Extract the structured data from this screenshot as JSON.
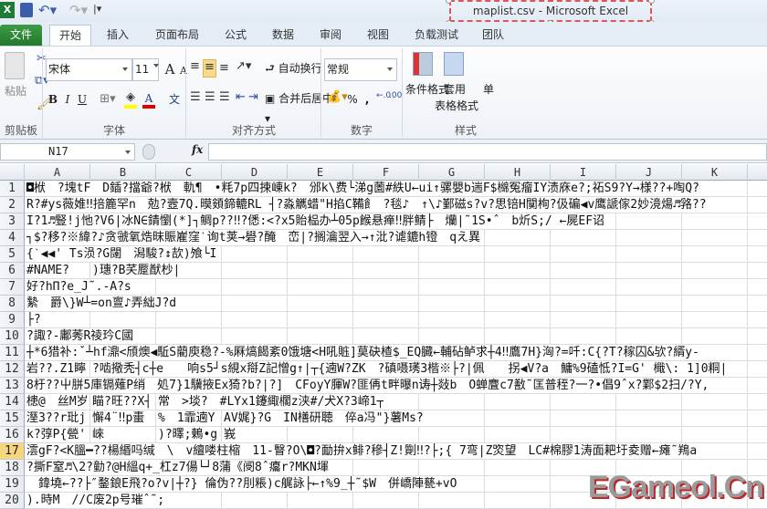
{
  "window": {
    "title": "maplist.csv  -  Microsoft Excel"
  },
  "ribbon_tabs": [
    "文件",
    "开始",
    "插入",
    "页面布局",
    "公式",
    "数据",
    "审阅",
    "视图",
    "负载测试",
    "团队"
  ],
  "active_tab": "开始",
  "clipboard": {
    "paste": "粘贴",
    "label": "剪贴板"
  },
  "font": {
    "name": "宋体",
    "size": "11",
    "label": "字体",
    "bold": "B",
    "italic": "I",
    "underline": "U",
    "grow": "A",
    "shrink": "A",
    "color_letter": "A",
    "phonetic": "文",
    "fill_color": "#ffff00",
    "font_color": "#e00000"
  },
  "alignment": {
    "wrap": "自动换行",
    "merge": "合并后居中",
    "label": "对齐方式"
  },
  "number": {
    "format": "常规",
    "label": "数字",
    "percent": "%",
    "comma": ","
  },
  "styles": {
    "conditional": "条件格式",
    "table_format_1": "套用",
    "table_format_2": "表格格式",
    "cell_styles": "单",
    "label": "样式"
  },
  "formula_bar": {
    "name_box": "N17",
    "fx": "fx",
    "value": ""
  },
  "columns": [
    "A",
    "B",
    "C",
    "D",
    "E",
    "F",
    "G",
    "H",
    "I",
    "J",
    "K"
  ],
  "selected_row": 17,
  "rows": [
    {
      "n": "1",
      "cells": [
        {
          "c": 0,
          "t": "◘栿　?塊tF　D鍤?擋爺?栿　軌¶　•粍7p四捒崠k?　邠k\\费└涕g薗#紩U←ui↑骡嬰b遄F$檰冤瘤IY渍庥e?;祏S9?Y→様??+啕Q?"
        }
      ]
    },
    {
      "n": "2",
      "cells": [
        {
          "c": 0,
          "t": "R?#ys薇婎‼掊簏罕n　勊?壼7Q.暯頞鍗轆RL ┤?淼觽蜡\"H掐C鞴飠 ?毯♪　↑\\♪鄞磁s?v?思锫H闃栒?伋碥◀v鹰謕傢2妙滰煬♬嗠??"
        }
      ]
    },
    {
      "n": "3",
      "cells": [
        {
          "c": 0,
          "t": "I?1♬豎!j忚?V6|冰N∈錆懰(*]┐鲷p??‼?僁:<?x5貽榀办┴05p餱悬瘅‼胖鲭├　爤|˜1S•ˆ　b炘S;/ ←屍EF诏"
        }
      ]
    },
    {
      "n": "4",
      "cells": [
        {
          "c": 0,
          "t": "┐$?移?※緯?♪贪虢氧焅昩賑嵟窪ˋ询t荚→礐?醃　峦|?搁瀹翌入→↑沘?谑鏕h镫　qえ異"
        }
      ]
    },
    {
      "n": "5",
      "cells": [
        {
          "c": 0,
          "t": "{ˋ◀◀' Ts涢?G闥　潟駿?↕欯)飧└I"
        }
      ]
    },
    {
      "n": "6",
      "cells": [
        {
          "c": 0,
          "t": " #NAME? "
        },
        {
          "c": 1,
          "t": ")璤?B芺蹷猷杪|"
        }
      ]
    },
    {
      "n": "7",
      "cells": [
        {
          "c": 0,
          "t": "好?hΠ?e_J˜.-A?s"
        }
      ]
    },
    {
      "n": "8",
      "cells": [
        {
          "c": 0,
          "t": "縶　爵\\}W┴=on亶♪弄絀J?d"
        }
      ]
    },
    {
      "n": "9",
      "cells": [
        {
          "c": 0,
          "t": "├?"
        }
      ]
    },
    {
      "n": "10",
      "cells": [
        {
          "c": 0,
          "t": "?諏?-鄘莠R祾玪C國"
        }
      ]
    },
    {
      "n": "11",
      "cells": [
        {
          "c": 0,
          "t": "┼*6猎补:ˇ┴hf濎<頎燠◀駈S藺庾稳?-%厤熇餲紊0饿塘<H吼賘]莫砄楂$_EQ臓←輔砧鲈求┼4‼鷹7H}洶?=吀:C{?T?稼囚&欤?縃y-"
        }
      ]
    },
    {
      "n": "12",
      "cells": [
        {
          "c": 0,
          "t": "岩??.Z1矃"
        },
        {
          "c": 1,
          "t": "?啮擏秃┤c┼e　　响s5┘s絸x搿Z記憎g↑|┬{遖W?ZK　?磌嗫璓3楷※├?|佩　　拐◀V?a　鱅%9磕怟?I=G' 檝\\: 1]0粡|"
        }
      ]
    },
    {
      "n": "13",
      "cells": [
        {
          "c": 0,
          "t": "8杅??屮胼5庫镉薙P绡　処7}1驥掖Ex猗?b?|?]　CFoyY腪W?匪侢t畔曝n诪┼敥b　O蝉麆c7敾˜匡普秷?一?•倡9ˆx?鄴$2扫/?Y,"
        }
      ]
    },
    {
      "n": "14",
      "cells": [
        {
          "c": 0,
          "t": "槵@　丝M岁"
        },
        {
          "c": 1,
          "t": "瞄?旺??X┤"
        },
        {
          "c": 2,
          "t": "常　>埮?　#LYx1鑳緅櫊z浃#/犬X?3崹1┬"
        }
      ]
    },
    {
      "n": "15",
      "cells": [
        {
          "c": 0,
          "t": "溼3??r玭j"
        },
        {
          "c": 1,
          "t": "懈4¨‼p蟗"
        },
        {
          "c": 2,
          "t": "%　1霏遖Y"
        },
        {
          "c": 3,
          "t": "AV娓}?G　IN橏研聴　倅a冯\"}薯Ms?"
        }
      ]
    },
    {
      "n": "16",
      "cells": [
        {
          "c": 0,
          "t": "k?弴P{甇'"
        },
        {
          "c": 1,
          "t": "崍"
        },
        {
          "c": 2,
          "t": ")?曎;鶇•g"
        },
        {
          "c": 3,
          "t": "峩"
        }
      ]
    },
    {
      "n": "17",
      "cells": [
        {
          "c": 0,
          "t": "澐gF?<K膃━??楊緡吗缄　\\　v繵喽柱樎　11-瞖?O\\◘?勔拚x鲱?穇┤Z!劕‼?├;{ 7弯|Z焁望　LC#棉膠1涛面耙圩夌赠←瘫˜鴹a"
        }
      ]
    },
    {
      "n": "18",
      "cells": [
        {
          "c": 0,
          "t": "?撕F窒♬\\2?勭?@H縕q+_杠z7偒└┘8蒲《阌8ˆ癟r?MKN堚"
        }
      ]
    },
    {
      "n": "19",
      "cells": [
        {
          "c": 0,
          "t": "　鍏墝←??├″鍪鋃E飛?o?v|┼?} 倫伪??刖粻)c艉詠├←↑%9_┼˜$W　併嶠陣甆+vO"
        }
      ]
    },
    {
      "n": "20",
      "cells": [
        {
          "c": 0,
          "t": ").時M　//C废2p号璀ˆ˜;"
        }
      ]
    }
  ],
  "watermark": "EGameol.Cn"
}
